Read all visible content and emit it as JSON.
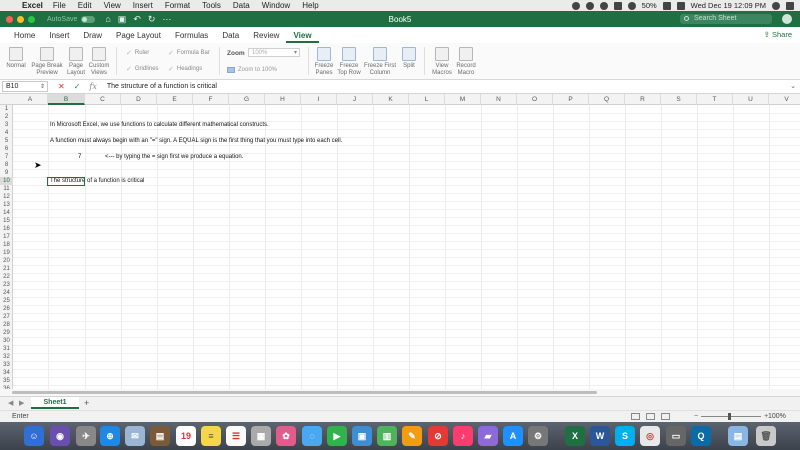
{
  "menubar": {
    "app_name": "Excel",
    "items": [
      "File",
      "Edit",
      "View",
      "Insert",
      "Format",
      "Tools",
      "Data",
      "Window",
      "Help"
    ],
    "battery": "50%",
    "clock": "Wed Dec 19  12:09 PM"
  },
  "titlebar": {
    "autosave_label": "AutoSave",
    "doc_title": "Book5",
    "search_placeholder": "Search Sheet"
  },
  "ribbon_tabs": {
    "items": [
      "Home",
      "Insert",
      "Draw",
      "Page Layout",
      "Formulas",
      "Data",
      "Review",
      "View"
    ],
    "active": "View",
    "share_label": "Share"
  },
  "ribbon": {
    "normal": "Normal",
    "page_break": "Page Break Preview",
    "page_layout": "Page Layout",
    "custom_views": "Custom Views",
    "ruler": "Ruler",
    "formula_bar": "Formula Bar",
    "gridlines": "Gridlines",
    "headings": "Headings",
    "zoom_label": "Zoom",
    "zoom_value": "100%",
    "zoom_to_100": "Zoom to 100%",
    "freeze_panes": "Freeze Panes",
    "freeze_top_row": "Freeze Top Row",
    "freeze_first_column": "Freeze First Column",
    "split": "Split",
    "view_macros": "View Macros",
    "record_macro": "Record Macro"
  },
  "formula_bar": {
    "name_box": "B10",
    "cancel_glyph": "✕",
    "enter_glyph": "✓",
    "fx_glyph": "fx",
    "content": "The structure of a function is critical"
  },
  "grid": {
    "columns": [
      "A",
      "B",
      "C",
      "D",
      "E",
      "F",
      "G",
      "H",
      "I",
      "J",
      "K",
      "L",
      "M",
      "N",
      "O",
      "P",
      "Q",
      "R",
      "S",
      "T",
      "U",
      "V"
    ],
    "selected_column": "B",
    "row_count": 36,
    "selected_row": 10,
    "cells": {
      "b3": "In Microsoft Excel, we use functions to calculate different mathematical constructs.",
      "b5": "A function must always begin with an \"=\" sign. A EQUAL sign is the first thing that you must type into each cell.",
      "b7": "7",
      "c7": "<--- by typing the = sign first we produce a equation.",
      "b10": "The structure of a function is critical"
    }
  },
  "sheets": {
    "tabs": [
      "Sheet1"
    ],
    "add_label": "+"
  },
  "status": {
    "mode": "Enter",
    "zoom": "100%",
    "zoom_level_percent": 100
  },
  "colors": {
    "excel_green": "#1f6f43",
    "selection_border": "#1f6f43"
  },
  "dock": {
    "calendar_day": "19"
  }
}
